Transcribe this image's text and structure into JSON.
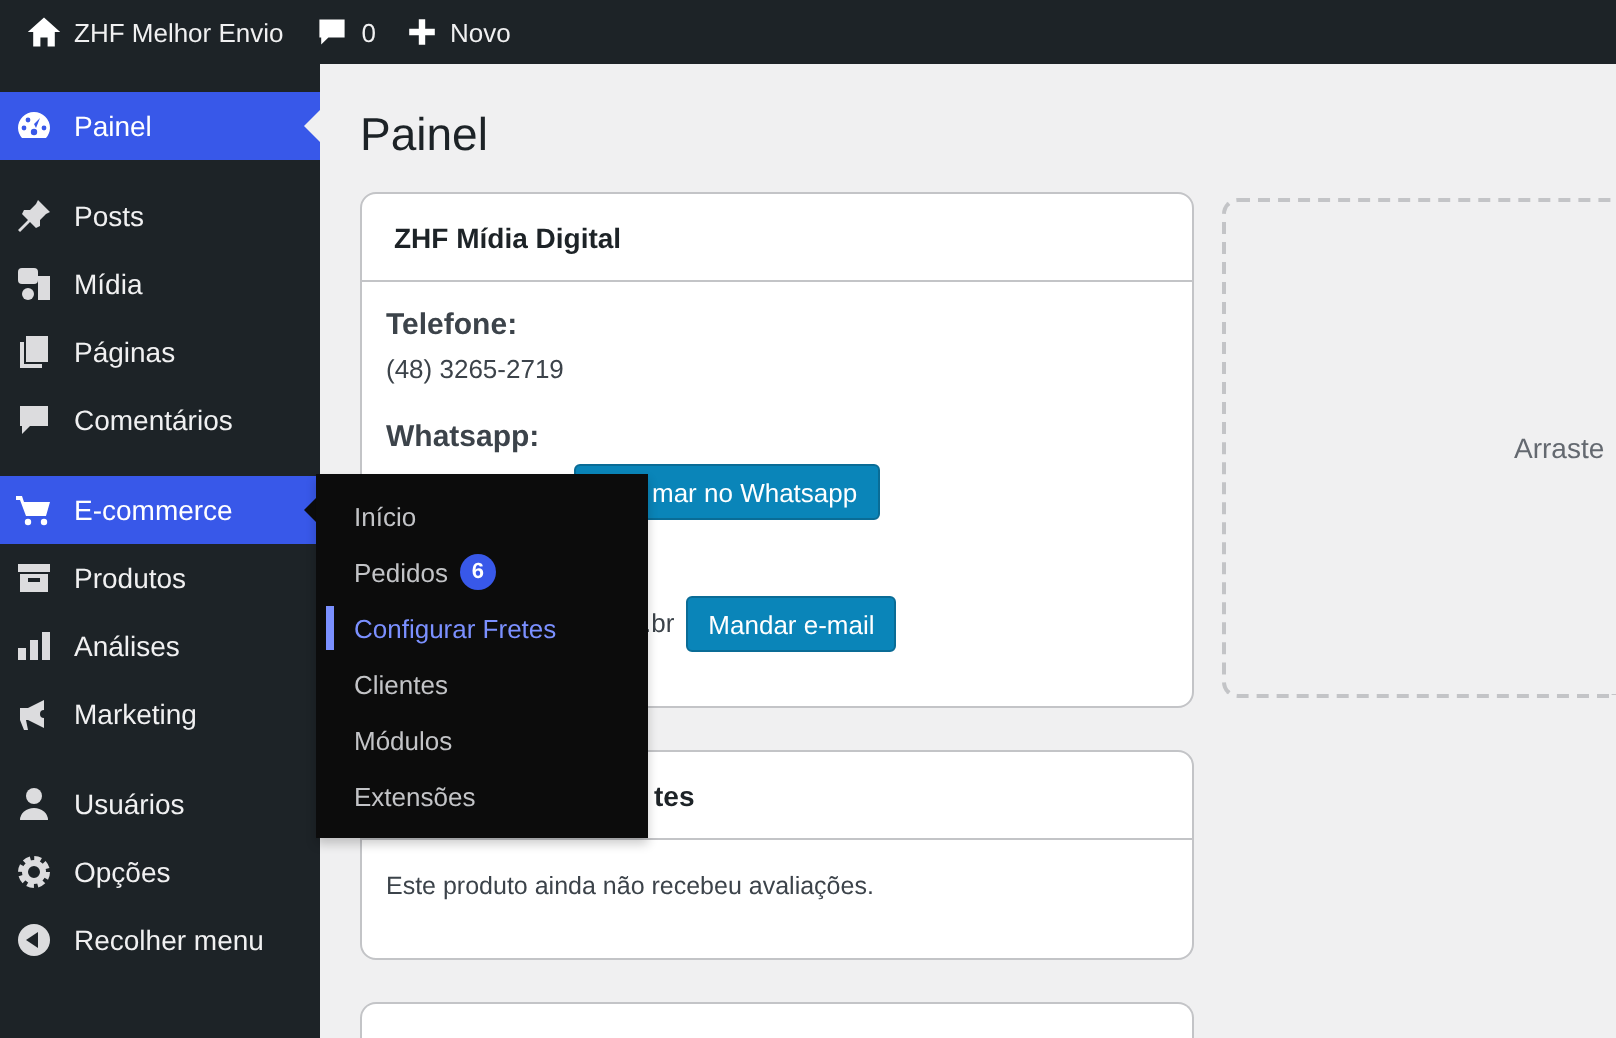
{
  "admin_bar": {
    "site_name": "ZHF Melhor Envio",
    "comments_count": "0",
    "new_label": "Novo"
  },
  "sidebar": {
    "groups": [
      {
        "items": [
          {
            "label": "Painel",
            "selected": true
          }
        ]
      },
      {
        "items": [
          {
            "label": "Posts",
            "selected": false
          },
          {
            "label": "Mídia",
            "selected": false
          },
          {
            "label": "Páginas",
            "selected": false
          },
          {
            "label": "Comentários",
            "selected": false
          }
        ]
      },
      {
        "items": [
          {
            "label": "E-commerce",
            "selected": true,
            "submenu": [
              {
                "label": "Início",
                "selected": false
              },
              {
                "label": "Pedidos",
                "selected": false,
                "badge": "6"
              },
              {
                "label": "Configurar Fretes",
                "selected": true
              },
              {
                "label": "Clientes",
                "selected": false
              },
              {
                "label": "Módulos",
                "selected": false
              },
              {
                "label": "Extensões",
                "selected": false
              }
            ]
          },
          {
            "label": "Produtos",
            "selected": false
          },
          {
            "label": "Análises",
            "selected": false
          },
          {
            "label": "Marketing",
            "selected": false
          }
        ]
      },
      {
        "items": [
          {
            "label": "Usuários",
            "selected": false
          },
          {
            "label": "Opções",
            "selected": false
          },
          {
            "label": "Recolher menu",
            "selected": false
          }
        ]
      }
    ]
  },
  "main": {
    "page_title": "Painel",
    "cards": [
      {
        "title": "ZHF Mídia Digital",
        "rows": [
          {
            "label": "Telefone:",
            "value": "(48) 3265-2719"
          },
          {
            "label": "Whatsapp:",
            "button": "mar no Whatsapp"
          },
          {
            "value": ".br",
            "button": "Mandar e-mail"
          }
        ]
      },
      {
        "title": "tes",
        "message": "Este produto ainda não recebeu avaliações."
      }
    ],
    "drop_zone": {
      "text": "Arraste"
    }
  }
}
